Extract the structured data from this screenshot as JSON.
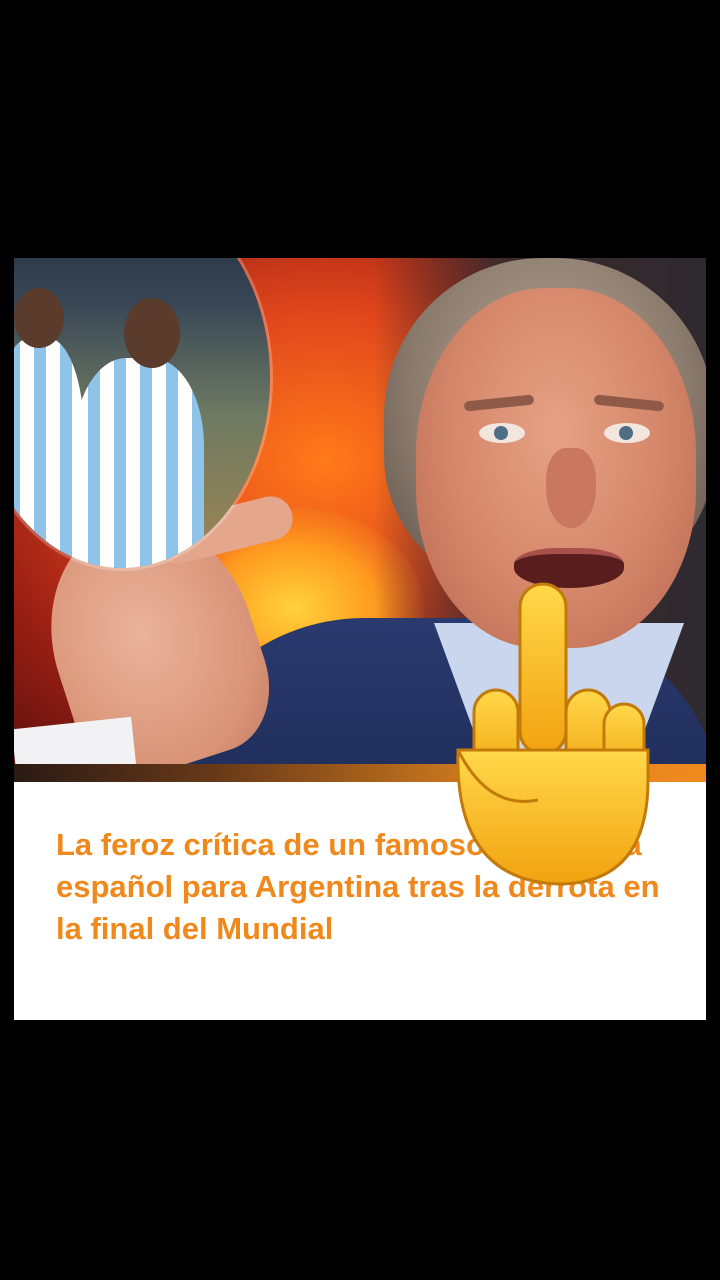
{
  "headline": "La feroz crítica de un famoso periodista español para Argentina tras la derrota en la final del Mundial",
  "overlay_icon": "middle-finger-emoji-icon",
  "colors": {
    "background": "#000000",
    "headline": "#f0891c",
    "accent_bar": "#f08a1e",
    "card": "#ffffff"
  }
}
